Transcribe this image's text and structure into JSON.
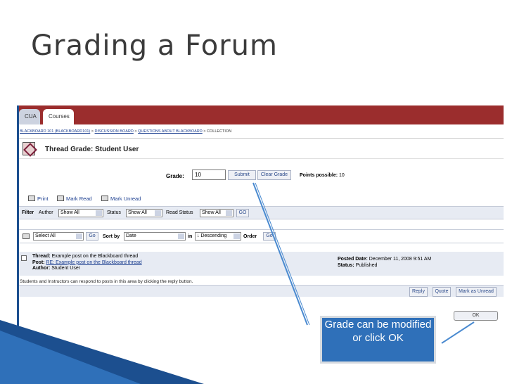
{
  "slide_title": "Grading a Forum",
  "tabs": [
    "CUA",
    "Courses"
  ],
  "breadcrumb": {
    "items": [
      "BLACKBOARD 101 (BLACKBOARD101)",
      "DISCUSSION BOARD",
      "QUESTIONS ABOUT BLACKBOARD"
    ],
    "separator": ">",
    "current": "COLLECTION"
  },
  "page_title": "Thread Grade: Student User",
  "grade": {
    "label": "Grade:",
    "value": "10",
    "submit_label": "Submit",
    "clear_label": "Clear Grade",
    "points_label": "Points possible:",
    "points_value": "10"
  },
  "actions": [
    "Print",
    "Mark Read",
    "Mark Unread"
  ],
  "filter": {
    "label": "Filter",
    "author_label": "Author",
    "author_value": "Show All",
    "status_label": "Status",
    "status_value": "Show All",
    "read_status_label": "Read Status",
    "read_status_value": "Show All",
    "go_label": "GO"
  },
  "sort": {
    "select_value": "Select All",
    "go1_label": "Go",
    "sort_by_label": "Sort by",
    "sort_by_value": "Date",
    "in_label": "in",
    "direction_value": "↓ Descending",
    "order_label": "Order",
    "go2_label": "Go"
  },
  "thread": {
    "thread_label": "Thread:",
    "thread_value": "Example post on the Blackboard thread",
    "post_label": "Post:",
    "post_value": "RE: Example post on the Blackboard thread",
    "author_label": "Author:",
    "author_value": "Student User",
    "posted_date_label": "Posted Date:",
    "posted_date_value": "December 11, 2008 9:51 AM",
    "status_label": "Status:",
    "status_value": "Published"
  },
  "note": "Students and Instructors can respond to posts in this area by clicking the reply button.",
  "reply_buttons": [
    "Reply",
    "Quote",
    "Mark as Unread"
  ],
  "ok_label": "OK",
  "callout_text": "Grade can be modified or click OK",
  "colors": {
    "top_bar": "#9b2d2d",
    "callout_bg": "#2f70b9",
    "link": "#1a3d8f",
    "arrow": "#4a8ad0"
  }
}
